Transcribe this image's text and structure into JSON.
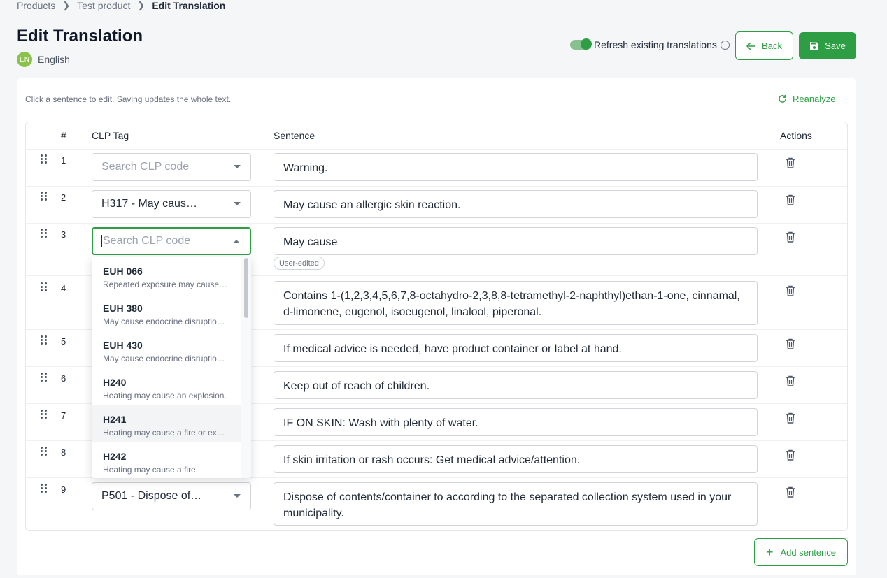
{
  "breadcrumb": {
    "items": [
      "Products",
      "Test product"
    ],
    "current": "Edit Translation"
  },
  "page": {
    "title": "Edit Translation",
    "language_code": "EN",
    "language_name": "English"
  },
  "header": {
    "refresh_label": "Refresh existing translations",
    "refresh_on": true,
    "back_label": "Back",
    "save_label": "Save"
  },
  "card": {
    "hint": "Click a sentence to edit. Saving updates the whole text.",
    "reanalyze_label": "Reanalyze",
    "add_sentence_label": "Add sentence"
  },
  "table": {
    "headers": {
      "num": "#",
      "clp": "CLP Tag",
      "sentence": "Sentence",
      "actions": "Actions"
    },
    "clp_placeholder": "Search CLP code",
    "user_edited_label": "User-edited",
    "rows": [
      {
        "num": "1",
        "clp": "",
        "sentence": "Warning."
      },
      {
        "num": "2",
        "clp": "H317 - May caus…",
        "sentence": "May cause an allergic skin reaction."
      },
      {
        "num": "3",
        "clp": "",
        "sentence": "May cause"
      },
      {
        "num": "4",
        "clp": "",
        "sentence": "Contains 1-(1,2,3,4,5,6,7,8-octahydro-2,3,8,8-tetramethyl-2-naphthyl)ethan-1-one, cinnamal, d-limonene, eugenol, isoeugenol, linalool, piperonal."
      },
      {
        "num": "5",
        "clp": "",
        "sentence": "If medical advice is needed, have product container or label at hand."
      },
      {
        "num": "6",
        "clp": "",
        "sentence": "Keep out of reach of children."
      },
      {
        "num": "7",
        "clp": "",
        "sentence": "IF ON SKIN: Wash with plenty of water."
      },
      {
        "num": "8",
        "clp": "",
        "sentence": "If skin irritation or rash occurs: Get medical advice/attention."
      },
      {
        "num": "9",
        "clp": "P501 - Dispose of…",
        "sentence": "Dispose of contents/container to according to the separated collection system used in your municipality."
      }
    ]
  },
  "dropdown": {
    "options": [
      {
        "code": "EUH 066",
        "desc": "Repeated exposure may cause skin dryness or cracking."
      },
      {
        "code": "EUH 380",
        "desc": "May cause endocrine disruption in humans."
      },
      {
        "code": "EUH 430",
        "desc": "May cause endocrine disruption in the environment."
      },
      {
        "code": "H240",
        "desc": "Heating may cause an explosion."
      },
      {
        "code": "H241",
        "desc": "Heating may cause a fire or explosion."
      },
      {
        "code": "H242",
        "desc": "Heating may cause a fire."
      }
    ]
  },
  "colors": {
    "accent": "#2e9e44",
    "language_badge": "#8bc34a"
  }
}
